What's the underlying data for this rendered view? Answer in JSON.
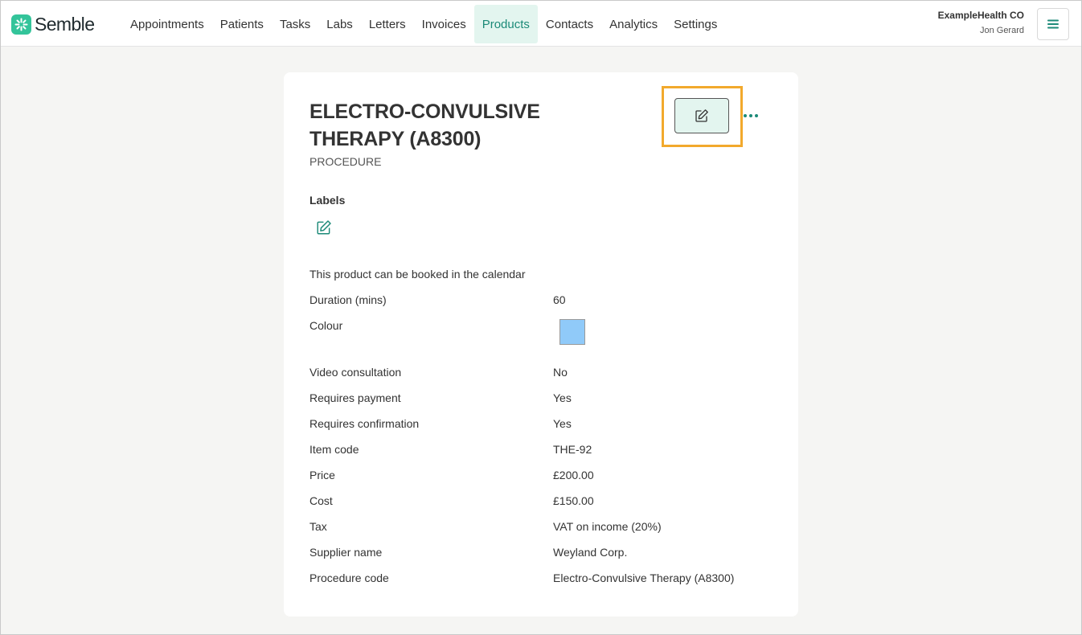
{
  "app": {
    "brand": "Semble",
    "org": "ExampleHealth CO",
    "user": "Jon Gerard"
  },
  "nav": {
    "items": [
      "Appointments",
      "Patients",
      "Tasks",
      "Labs",
      "Letters",
      "Invoices",
      "Products",
      "Contacts",
      "Analytics",
      "Settings"
    ],
    "active": "Products"
  },
  "product": {
    "title": "ELECTRO-CONVULSIVE THERAPY (A8300)",
    "type": "PROCEDURE",
    "labels_heading": "Labels",
    "bookable_text": "This product can be booked in the calendar",
    "colour_hex": "#90caf9",
    "fields": [
      {
        "key": "Duration (mins)",
        "value": "60"
      },
      {
        "key": "Colour",
        "value": ""
      },
      {
        "key": "Video consultation",
        "value": "No"
      },
      {
        "key": "Requires payment",
        "value": "Yes"
      },
      {
        "key": "Requires confirmation",
        "value": "Yes"
      },
      {
        "key": "Item code",
        "value": "THE-92"
      },
      {
        "key": "Price",
        "value": "£200.00"
      },
      {
        "key": "Cost",
        "value": "£150.00"
      },
      {
        "key": "Tax",
        "value": "VAT on income (20%)"
      },
      {
        "key": "Supplier name",
        "value": "Weyland Corp."
      },
      {
        "key": "Procedure code",
        "value": "Electro-Convulsive Therapy (A8300)"
      }
    ]
  },
  "colors": {
    "accent": "#1c8a78",
    "accent_bg": "#e3f5ef",
    "highlight": "#f2a92c",
    "brand_green": "#33c49a"
  },
  "icons": {
    "logo": "semble-logo-icon",
    "menu": "hamburger-menu-icon",
    "edit": "pencil-edit-icon",
    "more": "more-horizontal-icon"
  }
}
